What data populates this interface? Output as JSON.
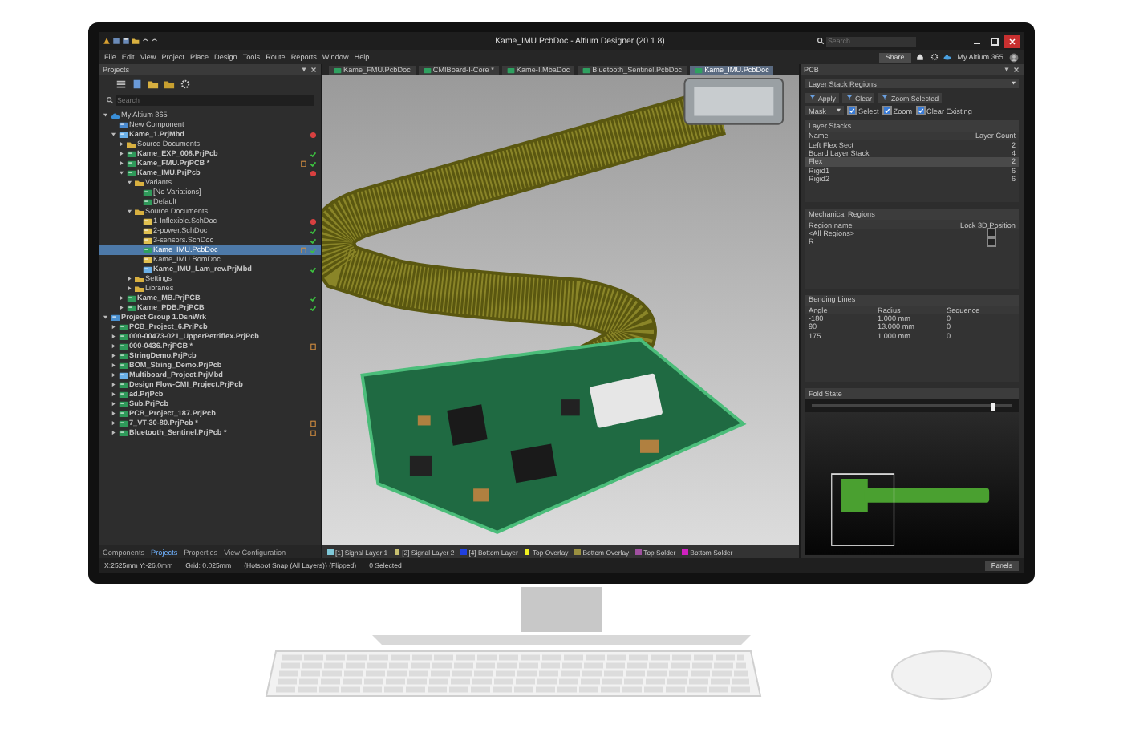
{
  "window": {
    "title": "Kame_IMU.PcbDoc - Altium Designer (20.1.8)",
    "search_placeholder": "Search",
    "share_button": "Share",
    "account": "My Altium 365"
  },
  "menu": [
    "File",
    "Edit",
    "View",
    "Project",
    "Place",
    "Design",
    "Tools",
    "Route",
    "Reports",
    "Window",
    "Help"
  ],
  "projects_panel": {
    "title": "Projects",
    "search_placeholder": "Search",
    "tree": [
      {
        "label": "My Altium 365",
        "kind": "cloud",
        "expanded": true,
        "selected": false,
        "children": [
          {
            "label": "New Component",
            "kind": "component",
            "selected": false
          },
          {
            "label": "Kame_1.PrjMbd",
            "kind": "multiboard",
            "expanded": true,
            "error": true,
            "selected": false,
            "children": [
              {
                "label": "Source Documents",
                "kind": "folder",
                "expanded": false,
                "selected": false
              },
              {
                "label": "Kame_EXP_008.PrjPcb",
                "kind": "project",
                "expanded": false,
                "ok": true,
                "selected": false
              },
              {
                "label": "Kame_FMU.PrjPCB *",
                "kind": "project",
                "expanded": false,
                "modified": true,
                "ok": true,
                "selected": false
              },
              {
                "label": "Kame_IMU.PrjPcb",
                "kind": "project",
                "expanded": true,
                "error": true,
                "selected": false,
                "children": [
                  {
                    "label": "Variants",
                    "kind": "folder",
                    "expanded": true,
                    "selected": false,
                    "children": [
                      {
                        "label": "[No Variations]",
                        "kind": "variant",
                        "selected": false
                      },
                      {
                        "label": "Default",
                        "kind": "variant",
                        "selected": false
                      }
                    ]
                  },
                  {
                    "label": "Source Documents",
                    "kind": "folder",
                    "expanded": true,
                    "selected": false,
                    "children": [
                      {
                        "label": "1-Inflexible.SchDoc",
                        "kind": "schematic",
                        "error": true,
                        "selected": false
                      },
                      {
                        "label": "2-power.SchDoc",
                        "kind": "schematic",
                        "ok": true,
                        "selected": false
                      },
                      {
                        "label": "3-sensors.SchDoc",
                        "kind": "schematic",
                        "ok": true,
                        "selected": false
                      },
                      {
                        "label": "Kame_IMU.PcbDoc",
                        "kind": "pcb",
                        "modified": true,
                        "ok": true,
                        "selected": true
                      },
                      {
                        "label": "Kame_IMU.BomDoc",
                        "kind": "schematic",
                        "selected": false
                      },
                      {
                        "label": "Kame_IMU_Lam_rev.PrjMbd",
                        "kind": "multiboard",
                        "ok": true,
                        "selected": false
                      }
                    ]
                  },
                  {
                    "label": "Settings",
                    "kind": "folder",
                    "expanded": false,
                    "selected": false
                  },
                  {
                    "label": "Libraries",
                    "kind": "folder",
                    "expanded": false,
                    "selected": false
                  }
                ]
              },
              {
                "label": "Kame_MB.PrjPCB",
                "kind": "project",
                "expanded": false,
                "ok": true,
                "selected": false
              },
              {
                "label": "Kame_PDB.PrjPCB",
                "kind": "project",
                "expanded": false,
                "ok": true,
                "selected": false
              }
            ]
          }
        ]
      },
      {
        "label": "Project Group 1.DsnWrk",
        "kind": "group",
        "expanded": true,
        "selected": false,
        "children": [
          {
            "label": "PCB_Project_6.PrjPcb",
            "kind": "project",
            "expanded": false,
            "selected": false
          },
          {
            "label": "000-00473-021_UpperPetriflex.PrjPcb",
            "kind": "project",
            "expanded": false,
            "selected": false
          },
          {
            "label": "000-0436.PrjPCB *",
            "kind": "project",
            "expanded": false,
            "modified": true,
            "selected": false
          },
          {
            "label": "StringDemo.PrjPcb",
            "kind": "project",
            "expanded": false,
            "selected": false
          },
          {
            "label": "BOM_String_Demo.PrjPcb",
            "kind": "project",
            "expanded": false,
            "selected": false
          },
          {
            "label": "Multiboard_Project.PrjMbd",
            "kind": "multiboard",
            "expanded": false,
            "selected": false
          },
          {
            "label": "Design Flow-CMI_Project.PrjPcb",
            "kind": "project",
            "expanded": false,
            "selected": false
          },
          {
            "label": "ad.PrjPcb",
            "kind": "project",
            "expanded": false,
            "selected": false
          },
          {
            "label": "Sub.PrjPcb",
            "kind": "project",
            "expanded": false,
            "selected": false
          },
          {
            "label": "PCB_Project_187.PrjPcb",
            "kind": "project",
            "expanded": false,
            "selected": false
          },
          {
            "label": "7_VT-30-80.PrjPcb *",
            "kind": "project",
            "expanded": false,
            "modified": true,
            "selected": false
          },
          {
            "label": "Bluetooth_Sentinel.PrjPcb *",
            "kind": "project",
            "expanded": false,
            "modified": true,
            "selected": false
          }
        ]
      }
    ],
    "tabs": [
      {
        "label": "Components",
        "selected": false
      },
      {
        "label": "Projects",
        "selected": true
      },
      {
        "label": "Properties",
        "selected": false
      },
      {
        "label": "View Configuration",
        "selected": false
      }
    ]
  },
  "document_tabs": [
    {
      "label": "Kame_FMU.PcbDoc",
      "selected": false
    },
    {
      "label": "CMIBoard-I-Core *",
      "selected": false
    },
    {
      "label": "Kame-I.MbaDoc",
      "selected": false
    },
    {
      "label": "Bluetooth_Sentinel.PcbDoc",
      "selected": false
    },
    {
      "label": "Kame_IMU.PcbDoc",
      "selected": true
    }
  ],
  "layer_tabs": [
    {
      "label": "[1] Signal Layer 1",
      "color": "#7fc8d8"
    },
    {
      "label": "[2] Signal Layer 2",
      "color": "#c8c070"
    },
    {
      "label": "[4] Bottom Layer",
      "color": "#2040e0"
    },
    {
      "label": "Top Overlay",
      "color": "#f0f020"
    },
    {
      "label": "Bottom Overlay",
      "color": "#9a9040"
    },
    {
      "label": "Top Solder",
      "color": "#a050a0"
    },
    {
      "label": "Bottom Solder",
      "color": "#d020c0"
    }
  ],
  "pcb_panel": {
    "title": "PCB",
    "mode": "Layer Stack Regions",
    "buttons": [
      "Apply",
      "Clear",
      "Zoom Selected"
    ],
    "mask": "Mask",
    "options": [
      {
        "label": "Select",
        "checked": true
      },
      {
        "label": "Zoom",
        "checked": true
      },
      {
        "label": "Clear Existing",
        "checked": true
      }
    ],
    "layer_stacks": {
      "title": "Layer Stacks",
      "columns": [
        "Name",
        "Layer Count"
      ],
      "rows": [
        {
          "name": "Left Flex Sect",
          "count": "2",
          "selected": false
        },
        {
          "name": "Board Layer Stack",
          "count": "4",
          "selected": false
        },
        {
          "name": "Flex",
          "count": "2",
          "selected": true
        },
        {
          "name": "Rigid1",
          "count": "6",
          "selected": false
        },
        {
          "name": "Rigid2",
          "count": "6",
          "selected": false
        }
      ]
    },
    "mechanical_regions": {
      "title": "Mechanical Regions",
      "columns": [
        "Region name",
        "Lock 3D Position"
      ],
      "rows": [
        {
          "name": "<All Regions>",
          "locked": false
        },
        {
          "name": "R",
          "locked": false
        }
      ]
    },
    "bending_lines": {
      "title": "Bending Lines",
      "columns": [
        "Angle",
        "Radius",
        "Sequence"
      ],
      "rows": [
        [
          "-180",
          "1.000 mm",
          "0"
        ],
        [
          "90",
          "13.000 mm",
          "0"
        ],
        [
          "175",
          "1.000 mm",
          "0"
        ]
      ]
    },
    "fold_state": {
      "title": "Fold State",
      "level": 0.9
    }
  },
  "status_bar": {
    "coordinates": "X:2525mm Y:-26.0mm",
    "grid": "Grid: 0.025mm",
    "snap": "(Hotspot Snap (All Layers)) (Flipped)",
    "selection": "0 Selected",
    "panels_button": "Panels"
  }
}
